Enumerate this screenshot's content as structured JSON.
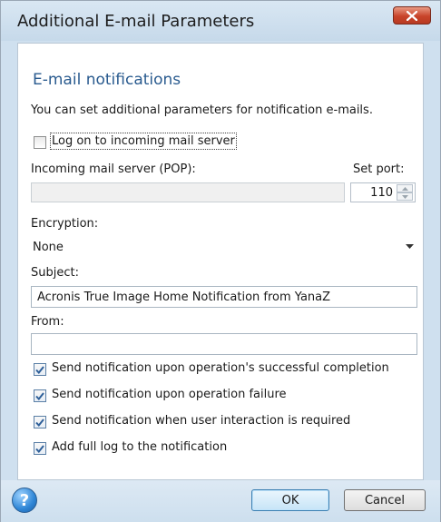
{
  "window": {
    "title": "Additional E-mail Parameters"
  },
  "section": {
    "heading": "E-mail notifications",
    "description": "You can set additional parameters for notification e-mails."
  },
  "log_on": {
    "label": "Log on to incoming mail server",
    "checked": false
  },
  "incoming_server": {
    "label": "Incoming mail server (POP):",
    "value": ""
  },
  "port": {
    "label": "Set port:",
    "value": "110"
  },
  "encryption": {
    "label": "Encryption:",
    "selected": "None"
  },
  "subject": {
    "label": "Subject:",
    "value": "Acronis True Image Home Notification from YanaZ"
  },
  "from": {
    "label": "From:",
    "value": ""
  },
  "options": [
    {
      "label": "Send notification upon operation's successful completion",
      "checked": true
    },
    {
      "label": "Send notification upon operation failure",
      "checked": true
    },
    {
      "label": "Send notification when user interaction is required",
      "checked": true
    },
    {
      "label": "Add full log to the notification",
      "checked": true
    }
  ],
  "buttons": {
    "ok": "OK",
    "cancel": "Cancel",
    "help_glyph": "?"
  },
  "colors": {
    "accent": "#2a5b8f",
    "window_frame": "#cfe0ef",
    "close": "#c8442a"
  },
  "icons": [
    "close-icon",
    "checkmark-icon",
    "spin-up-icon",
    "spin-down-icon",
    "dropdown-arrow-icon",
    "help-icon"
  ]
}
